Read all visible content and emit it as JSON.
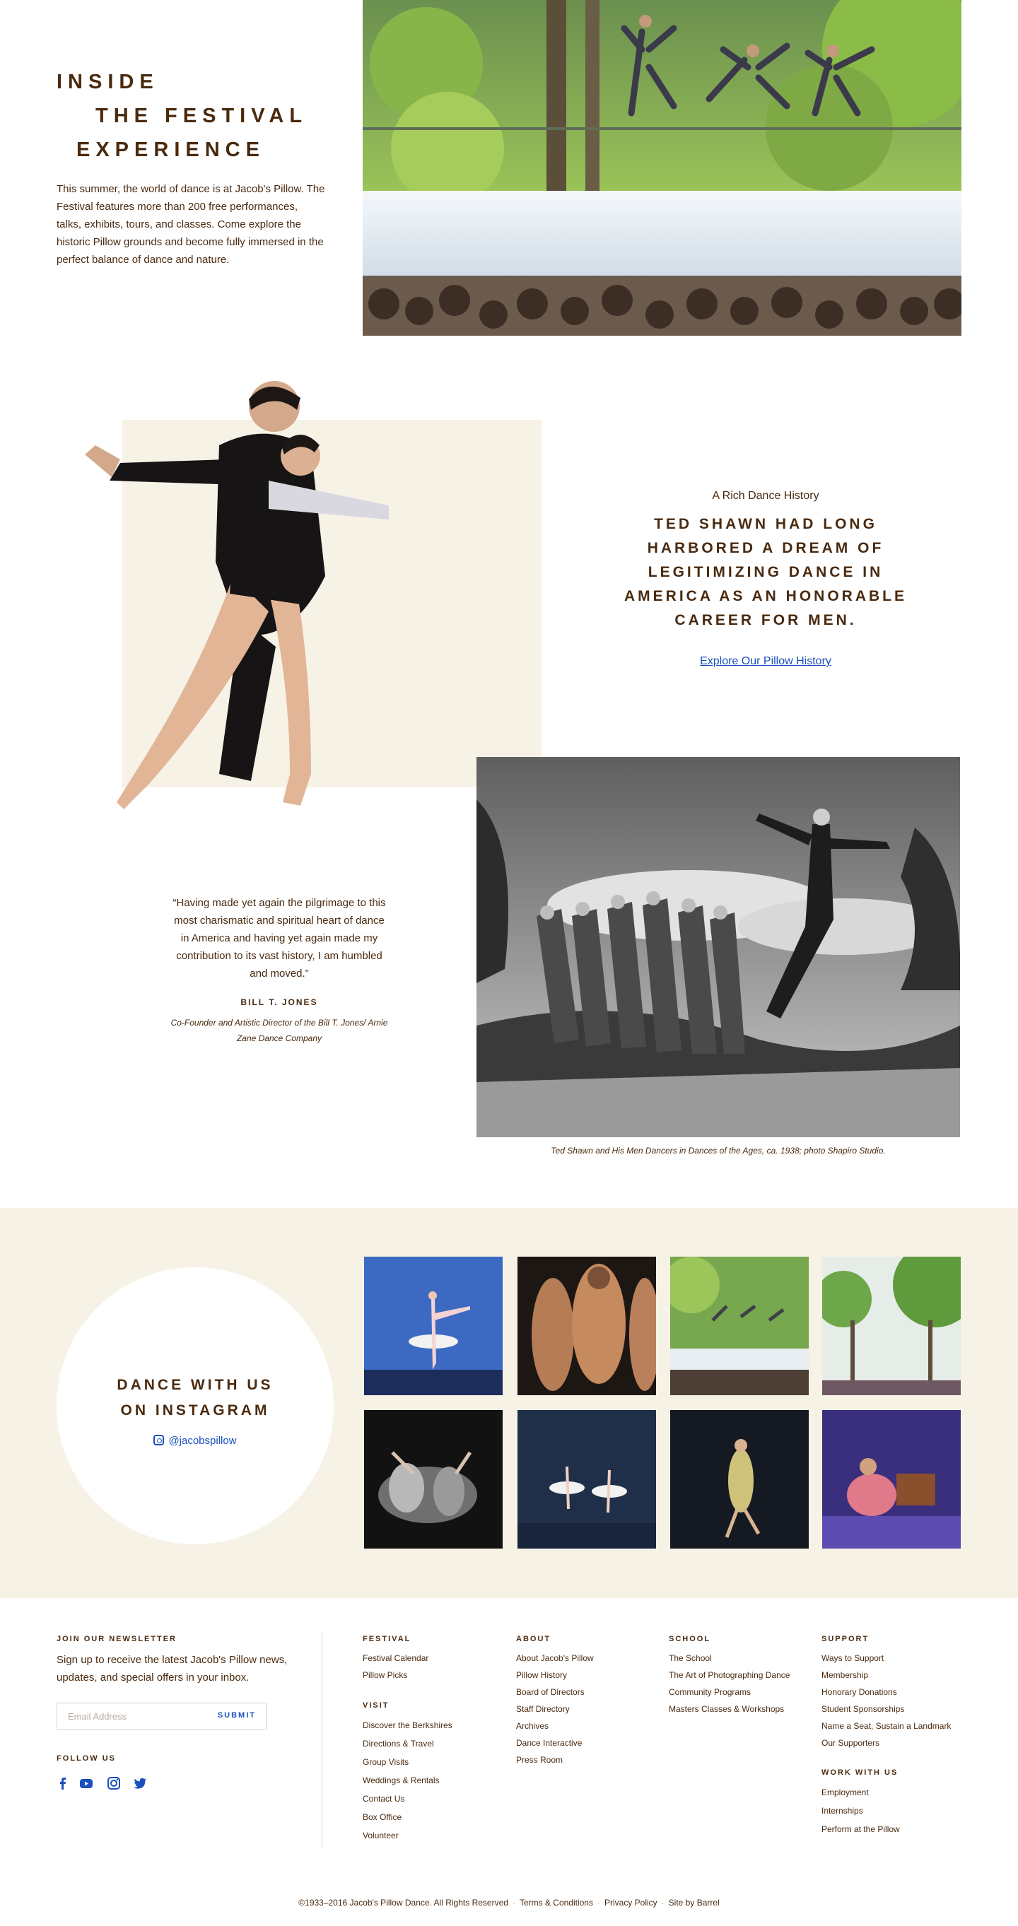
{
  "intro": {
    "title_lines": [
      "INSIDE",
      "THE FESTIVAL",
      "EXPERIENCE"
    ],
    "body": "This summer, the world of dance is at Jacob's Pillow. The Festival features more than 200 free performances, talks, exhibits, tours, and classes. Come explore the historic Pillow grounds and become fully immersed in the perfect balance of dance and nature."
  },
  "history": {
    "kicker": "A Rich Dance History",
    "quote": "TED SHAWN HAD LONG HARBORED A DREAM OF LEGITIMIZING DANCE IN AMERICA AS AN HONORABLE CAREER FOR MEN.",
    "link": "Explore Our Pillow History",
    "photo_caption": "Ted Shawn and His Men Dancers in Dances of the Ages, ca. 1938; photo Shapiro Studio."
  },
  "testimonial": {
    "quote": "“Having made yet again the pilgrimage to this most charismatic and spiritual heart of dance in America and having yet again made my contribution to its vast history, I am humbled and moved.”",
    "name": "BILL T. JONES",
    "role": "Co-Founder and Artistic Director of the Bill T. Jones/ Arnie Zane Dance Company"
  },
  "instagram": {
    "title_lines": [
      "DANCE WITH US",
      "ON INSTAGRAM"
    ],
    "handle": "@jacobspillow",
    "icon": "instagram-icon"
  },
  "newsletter": {
    "heading": "JOIN OUR NEWSLETTER",
    "text": "Sign up to receive the latest Jacob's Pillow news, updates, and special offers in your inbox.",
    "placeholder": "Email Address",
    "submit": "SUBMIT"
  },
  "follow": {
    "heading": "FOLLOW US",
    "icons": [
      "facebook-icon",
      "youtube-icon",
      "instagram-icon",
      "twitter-icon"
    ]
  },
  "footer_columns": {
    "festival": {
      "heading": "FESTIVAL",
      "items": [
        "Festival Calendar",
        "Pillow Picks"
      ]
    },
    "visit": {
      "heading": "VISIT",
      "items": [
        "Discover the Berkshires",
        "Directions & Travel",
        "Group Visits",
        "Weddings & Rentals",
        "Contact Us",
        "Box Office",
        "Volunteer"
      ]
    },
    "about": {
      "heading": "ABOUT",
      "items": [
        "About Jacob's Pillow",
        "Pillow History",
        "Board of Directors",
        "Staff Directory",
        "Archives",
        "Dance Interactive",
        "Press Room"
      ]
    },
    "school": {
      "heading": "SCHOOL",
      "items": [
        "The School",
        "The Art of Photographing Dance",
        "Community Programs",
        "Masters Classes & Workshops"
      ]
    },
    "support": {
      "heading": "SUPPORT",
      "items": [
        "Ways to Support",
        "Membership",
        "Honorary Donations",
        "Student Sponsorships",
        "Name a Seat, Sustain a Landmark",
        "Our Supporters"
      ]
    },
    "work": {
      "heading": "WORK WITH US",
      "items": [
        "Employment",
        "Internships",
        "Perform at the Pillow"
      ]
    }
  },
  "legal": {
    "copyright": "©1933–2016 Jacob's Pillow Dance. All Rights Reserved",
    "terms": "Terms & Conditions",
    "privacy": "Privacy Policy",
    "credit": "Site by Barrel"
  },
  "colors": {
    "brown_text": "#4a2a0f",
    "beige": "#f7f2e6",
    "link_blue": "#1a4fbd"
  }
}
